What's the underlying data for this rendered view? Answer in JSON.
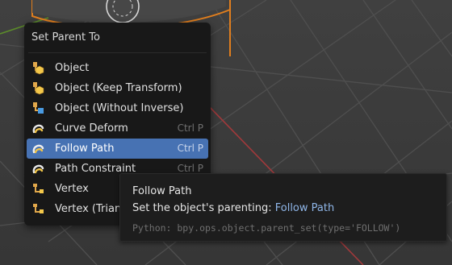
{
  "menu": {
    "title": "Set Parent To",
    "items": [
      {
        "label": "Object",
        "icon": "object-parent-icon",
        "shortcut": ""
      },
      {
        "label": "Object (Keep Transform)",
        "icon": "object-keep-transform-icon",
        "shortcut": ""
      },
      {
        "label": "Object (Without Inverse)",
        "icon": "object-without-inverse-icon",
        "shortcut": ""
      },
      {
        "label": "Curve Deform",
        "icon": "curve-deform-icon",
        "shortcut": "Ctrl P"
      },
      {
        "label": "Follow Path",
        "icon": "follow-path-icon",
        "shortcut": "Ctrl P",
        "highlighted": true
      },
      {
        "label": "Path Constraint",
        "icon": "path-constraint-icon",
        "shortcut": "Ctrl P"
      },
      {
        "label": "Vertex",
        "icon": "vertex-parent-icon",
        "shortcut": ""
      },
      {
        "label": "Vertex (Triangle)",
        "icon": "vertex-triangle-parent-icon",
        "shortcut": ""
      }
    ]
  },
  "tooltip": {
    "title": "Follow Path",
    "description": "Set the object's parenting:",
    "operation": "Follow Path",
    "python": "Python: bpy.ops.object.parent_set(type='FOLLOW')"
  },
  "colors": {
    "menu_bg": "#181818",
    "highlight": "#4772b3",
    "tooltip_bg": "#1d1d1d",
    "viewport_bg": "#3b3b3b",
    "x_axis": "#a0393b",
    "y_axis": "#5c8c2a",
    "selection_outline": "#e07e1e"
  }
}
